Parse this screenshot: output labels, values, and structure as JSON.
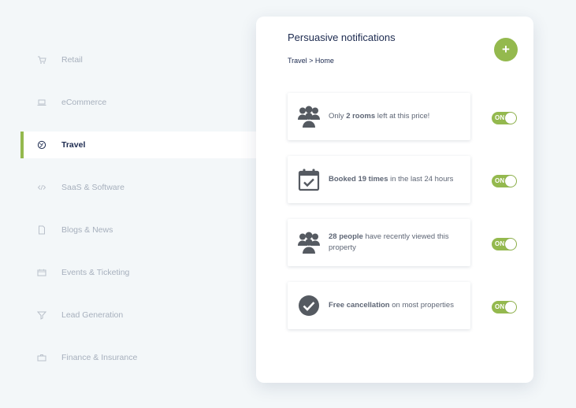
{
  "sidebar": {
    "items": [
      {
        "label": "Retail",
        "icon": "cart-icon"
      },
      {
        "label": "eCommerce",
        "icon": "laptop-icon"
      },
      {
        "label": "Travel",
        "icon": "globe-icon",
        "active": true
      },
      {
        "label": "SaaS & Software",
        "icon": "code-icon"
      },
      {
        "label": "Blogs & News",
        "icon": "document-icon"
      },
      {
        "label": "Events & Ticketing",
        "icon": "ticket-icon"
      },
      {
        "label": "Lead Generation",
        "icon": "funnel-icon"
      },
      {
        "label": "Finance & Insurance",
        "icon": "briefcase-icon"
      }
    ]
  },
  "card": {
    "title": "Persuasive notifications",
    "breadcrumb": "Travel > Home",
    "add_label": "+",
    "notifications": [
      {
        "icon": "people-group-icon",
        "pre": "Only ",
        "bold": "2 rooms",
        "post": " left at this price!",
        "toggle": "ON"
      },
      {
        "icon": "calendar-check-icon",
        "pre": "",
        "bold": "Booked 19 times",
        "post": " in the last 24 hours",
        "toggle": "ON"
      },
      {
        "icon": "people-group-icon",
        "pre": "",
        "bold": "28 people",
        "post": " have recently viewed this property",
        "toggle": "ON"
      },
      {
        "icon": "check-circle-icon",
        "pre": "",
        "bold": "Free cancellation",
        "post": " on most properties",
        "toggle": "ON"
      }
    ]
  },
  "colors": {
    "accent": "#94b94e",
    "background": "#f3f7f9",
    "title": "#1c2a4f",
    "muted": "#a7b0bd",
    "icon": "#555a61"
  }
}
